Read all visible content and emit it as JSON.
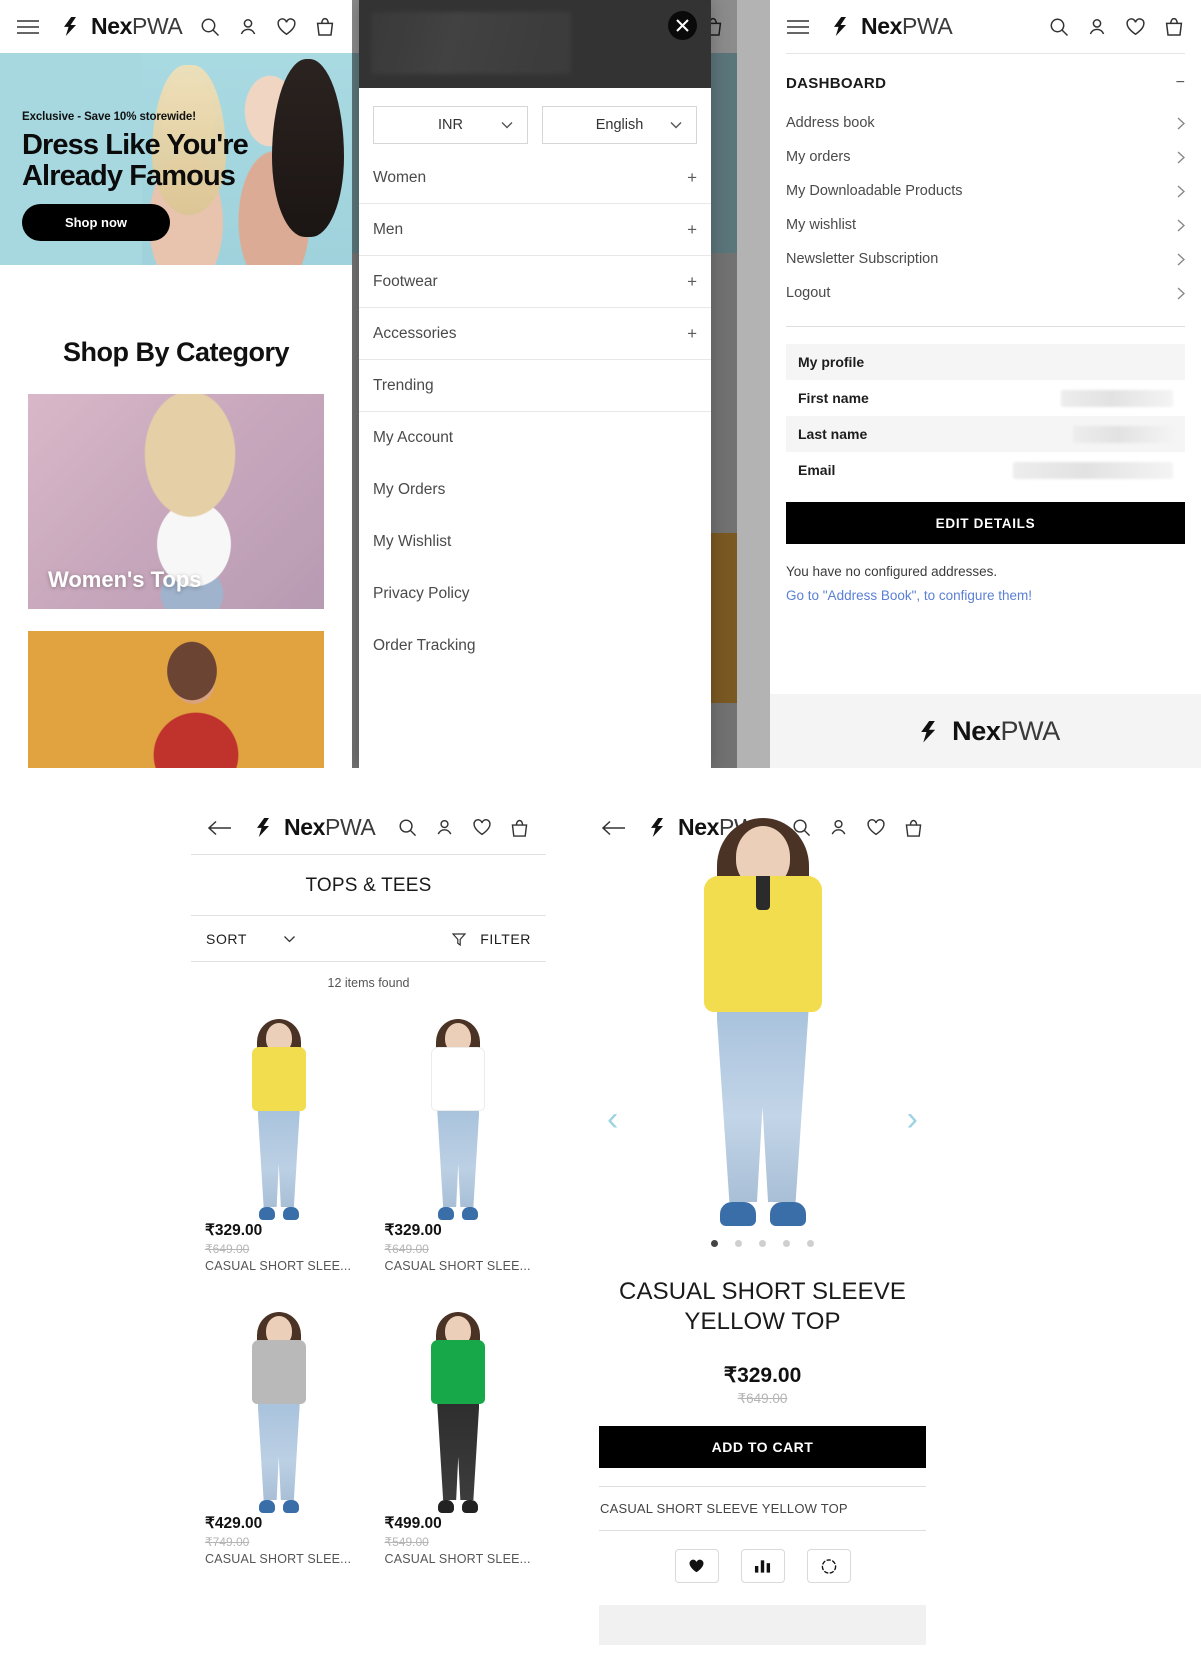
{
  "brand": {
    "name_bold": "Nex",
    "name_light": "PWA"
  },
  "home": {
    "header_icons": [
      "hamburger-icon",
      "search-icon",
      "account-icon",
      "wishlist-icon",
      "cart-icon"
    ],
    "hero": {
      "kicker": "Exclusive - Save 10% storewide!",
      "title_line1": "Dress Like You're",
      "title_line2": "Already Famous",
      "cta": "Shop now"
    },
    "section_title": "Shop By Category",
    "categories": [
      {
        "label": "Women's Tops"
      },
      {
        "label": ""
      }
    ]
  },
  "drawer": {
    "close_label": "✕",
    "currency": {
      "value": "INR",
      "options": [
        "INR"
      ]
    },
    "language": {
      "value": "English",
      "options": [
        "English"
      ]
    },
    "items": [
      {
        "label": "Women",
        "expander": "+"
      },
      {
        "label": "Men",
        "expander": "+"
      },
      {
        "label": "Footwear",
        "expander": "+"
      },
      {
        "label": "Accessories",
        "expander": "+"
      },
      {
        "label": "Trending",
        "expander": ""
      },
      {
        "label": "My Account",
        "expander": ""
      },
      {
        "label": "My Orders",
        "expander": ""
      },
      {
        "label": "My Wishlist",
        "expander": ""
      },
      {
        "label": "Privacy Policy",
        "expander": ""
      },
      {
        "label": "Order Tracking",
        "expander": ""
      }
    ]
  },
  "account": {
    "dashboard_title": "DASHBOARD",
    "collapse_glyph": "−",
    "nav": [
      {
        "label": "Address book"
      },
      {
        "label": "My orders"
      },
      {
        "label": "My Downloadable Products"
      },
      {
        "label": "My wishlist"
      },
      {
        "label": "Newsletter Subscription"
      },
      {
        "label": "Logout"
      }
    ],
    "profile": {
      "heading": "My profile",
      "rows": [
        {
          "label": "First name",
          "value": "",
          "masked": true
        },
        {
          "label": "Last name",
          "value": "",
          "masked": true
        },
        {
          "label": "Email",
          "value": "",
          "masked": true
        }
      ],
      "edit_label": "EDIT DETAILS"
    },
    "address_note": "You have no configured addresses.",
    "address_link": "Go to \"Address Book\", to configure them!",
    "link_color": "#5b7fd4"
  },
  "listing": {
    "back_icon": "back-arrow-icon",
    "title": "TOPS & TEES",
    "sort_label": "SORT",
    "filter_label": "FILTER",
    "count_text": "12 items found",
    "products": [
      {
        "price": "₹329.00",
        "old_price": "₹649.00",
        "name": "CASUAL SHORT SLEE...",
        "shirt_color": "#f2dd4e"
      },
      {
        "price": "₹329.00",
        "old_price": "₹649.00",
        "name": "CASUAL SHORT SLEE...",
        "shirt_color": "#ffffff"
      },
      {
        "price": "₹429.00",
        "old_price": "₹749.00",
        "name": "CASUAL SHORT SLEE...",
        "shirt_color": "#b9b9b9"
      },
      {
        "price": "₹499.00",
        "old_price": "₹549.00",
        "name": "CASUAL SHORT SLEE...",
        "shirt_color": "#17a84a"
      }
    ]
  },
  "product": {
    "back_icon": "back-arrow-icon",
    "prev_glyph": "‹",
    "next_glyph": "›",
    "gallery_dots": 5,
    "active_dot": 0,
    "title": "CASUAL SHORT SLEEVE YELLOW TOP",
    "price": "₹329.00",
    "old_price": "₹649.00",
    "add_to_cart": "ADD TO CART",
    "sku_line": "CASUAL SHORT SLEEVE YELLOW TOP",
    "actions": [
      "wishlist-heart-icon",
      "compare-bars-icon",
      "360-view-icon"
    ]
  }
}
